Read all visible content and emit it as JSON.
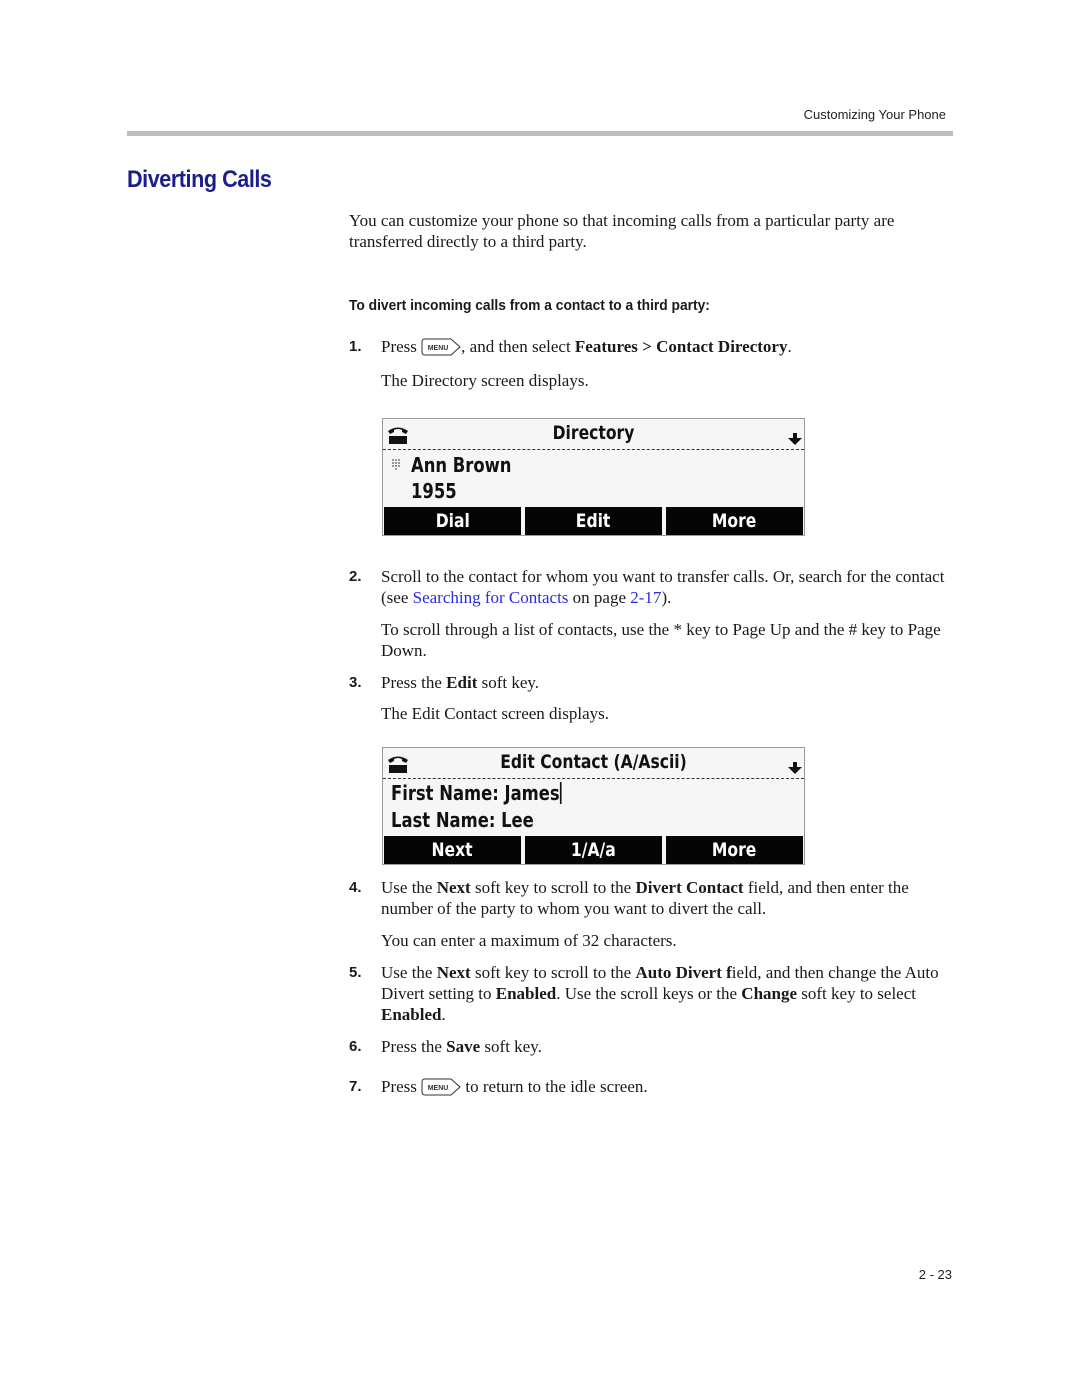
{
  "header": {
    "running_title": "Customizing Your Phone",
    "page_number": "2 - 23"
  },
  "section": {
    "title": "Diverting Calls",
    "intro": "You can customize your phone so that incoming calls from a particular party are transferred directly to a third party.",
    "procedure_heading": "To divert incoming calls from a contact to a third party:"
  },
  "icons": {
    "menu_key": "MENU"
  },
  "steps": [
    {
      "num": "1.",
      "press": "Press",
      "after_key": ", and then select",
      "features": "Features",
      "sep": ">",
      "contact_directory": "Contact Directory",
      "end": ".",
      "sub": "The Directory screen displays."
    },
    {
      "num": "2.",
      "text_a": "Scroll to the contact for whom you want to transfer calls. Or, search for the contact (see",
      "link_text": "Searching for Contacts",
      "text_b": "on page",
      "page_link": "2-17",
      "text_c": ").",
      "sub": "To scroll through a list of contacts, use the * key to Page Up and the # key to Page Down."
    },
    {
      "num": "3.",
      "text_a": "Press the",
      "bold": "Edit",
      "text_b": "soft key.",
      "sub": "The Edit Contact screen displays."
    },
    {
      "num": "4.",
      "text_a": "Use the",
      "bold_a": "Next",
      "text_b": "soft key to scroll to the",
      "bold_b": "Divert Contact",
      "text_c": "field, and then enter the number of the party to whom you want to divert the call.",
      "sub": "You can enter a maximum of 32 characters."
    },
    {
      "num": "5.",
      "text_a": "Use the",
      "bold_a": "Next",
      "text_b": "soft key to scroll to the",
      "bold_b": "Auto Divert f",
      "text_c": "ield, and then change the Auto Divert setting to",
      "bold_c": "Enabled",
      "text_d": ". Use the scroll keys or the",
      "bold_d": "Change",
      "text_e": "soft key to select",
      "bold_e": "Enabled",
      "text_f": "."
    },
    {
      "num": "6.",
      "text_a": "Press the",
      "bold": "Save",
      "text_b": "soft key."
    },
    {
      "num": "7.",
      "press": "Press",
      "text_b": "to return to the idle screen."
    }
  ],
  "directory_screen": {
    "title": "Directory",
    "name": "Ann Brown",
    "number": "1955",
    "softkeys": [
      "Dial",
      "Edit",
      "More"
    ]
  },
  "edit_contact_screen": {
    "title": "Edit Contact (A/Ascii)",
    "first_name": "First Name: James",
    "last_name": "Last Name: Lee",
    "softkeys": [
      "Next",
      "1/A/a",
      "More"
    ]
  },
  "colors": {
    "title_blue": "#1b1f8c",
    "link_blue": "#2a2adf",
    "rule_gray": "#bdbdbd"
  }
}
